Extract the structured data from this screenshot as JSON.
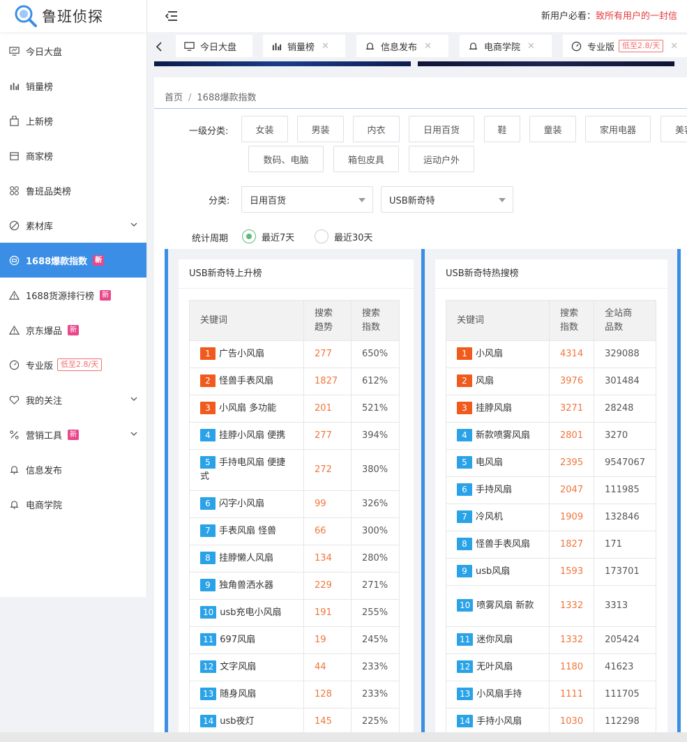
{
  "logo": {
    "text": "鲁班侦探"
  },
  "sidebar": {
    "items": [
      {
        "label": "今日大盘",
        "icon": "monitor-icon"
      },
      {
        "label": "销量榜",
        "icon": "bar-chart-icon"
      },
      {
        "label": "上新榜",
        "icon": "bag-icon"
      },
      {
        "label": "商家榜",
        "icon": "store-icon"
      },
      {
        "label": "鲁班品类榜",
        "icon": "grid-icon"
      },
      {
        "label": "素材库",
        "icon": "compass-icon"
      },
      {
        "label": "1688爆款指数",
        "icon": "dashboard-icon",
        "badge": "新"
      },
      {
        "label": "1688货源排行榜",
        "icon": "warning-icon",
        "badge": "新"
      },
      {
        "label": "京东爆品",
        "icon": "warning-icon",
        "badge": "新"
      },
      {
        "label": "专业版",
        "icon": "gauge-icon",
        "price_tag": "低至2.8/天"
      },
      {
        "label": "我的关注",
        "icon": "heart-icon"
      },
      {
        "label": "营销工具",
        "icon": "tools-icon",
        "badge": "新"
      },
      {
        "label": "信息发布",
        "icon": "bell-icon"
      },
      {
        "label": "电商学院",
        "icon": "bell-icon"
      }
    ]
  },
  "topbar": {
    "notice_label": "新用户必看：",
    "notice_link": "致所有用户的一封信"
  },
  "tabs": [
    {
      "label": "今日大盘"
    },
    {
      "label": "销量榜"
    },
    {
      "label": "信息发布"
    },
    {
      "label": "电商学院"
    },
    {
      "label": "专业版",
      "price_tag": "低至2.8/天"
    }
  ],
  "breadcrumb": {
    "home": "首页",
    "sep": "/",
    "current": "1688爆款指数"
  },
  "filters": {
    "level1_label": "一级分类:",
    "categories": [
      "女装",
      "男装",
      "内衣",
      "日用百货",
      "鞋",
      "童装",
      "家用电器",
      "美容",
      "数码、电脑",
      "箱包皮具",
      "运动户外"
    ],
    "category_label": "分类:",
    "select1": "日用百货",
    "select2": "USB新奇特",
    "period_label": "统计周期",
    "period_options": [
      "最近7天",
      "最近30天"
    ]
  },
  "rising": {
    "title": "USB新奇特上升榜",
    "headers": [
      "关键词",
      "搜索\n趋势",
      "搜索\n指数"
    ],
    "rows": [
      {
        "rank": "1",
        "keyword": "广告小风扇",
        "trend": "277",
        "index": "650%"
      },
      {
        "rank": "2",
        "keyword": "怪兽手表风扇",
        "trend": "1827",
        "index": "612%"
      },
      {
        "rank": "3",
        "keyword": "小风扇 多功能",
        "trend": "201",
        "index": "521%"
      },
      {
        "rank": "4",
        "keyword": "挂脖小风扇 便携",
        "trend": "277",
        "index": "394%"
      },
      {
        "rank": "5",
        "keyword": "手持电风扇 便捷式",
        "trend": "272",
        "index": "380%"
      },
      {
        "rank": "6",
        "keyword": "闪字小风扇",
        "trend": "99",
        "index": "326%"
      },
      {
        "rank": "7",
        "keyword": "手表风扇 怪兽",
        "trend": "66",
        "index": "300%"
      },
      {
        "rank": "8",
        "keyword": "挂脖懒人风扇",
        "trend": "134",
        "index": "280%"
      },
      {
        "rank": "9",
        "keyword": "独角兽洒水器",
        "trend": "229",
        "index": "271%"
      },
      {
        "rank": "10",
        "keyword": "usb充电小风扇",
        "trend": "191",
        "index": "255%"
      },
      {
        "rank": "11",
        "keyword": "697风扇",
        "trend": "19",
        "index": "245%"
      },
      {
        "rank": "12",
        "keyword": "文字风扇",
        "trend": "44",
        "index": "233%"
      },
      {
        "rank": "13",
        "keyword": "随身风扇",
        "trend": "128",
        "index": "233%"
      },
      {
        "rank": "14",
        "keyword": "usb夜灯",
        "trend": "145",
        "index": "225%"
      }
    ]
  },
  "hot": {
    "title": "USB新奇特热搜榜",
    "headers": [
      "关键词",
      "搜索\n指数",
      "全站商\n品数"
    ],
    "rows": [
      {
        "rank": "1",
        "keyword": "小风扇",
        "index": "4314",
        "count": "329088"
      },
      {
        "rank": "2",
        "keyword": "风扇",
        "index": "3976",
        "count": "301484"
      },
      {
        "rank": "3",
        "keyword": "挂脖风扇",
        "index": "3271",
        "count": "28248"
      },
      {
        "rank": "4",
        "keyword": "新款喷雾风扇",
        "index": "2801",
        "count": "3270"
      },
      {
        "rank": "5",
        "keyword": "电风扇",
        "index": "2395",
        "count": "9547067"
      },
      {
        "rank": "6",
        "keyword": "手持风扇",
        "index": "2047",
        "count": "111985"
      },
      {
        "rank": "7",
        "keyword": "冷风机",
        "index": "1909",
        "count": "132846"
      },
      {
        "rank": "8",
        "keyword": "怪兽手表风扇",
        "index": "1827",
        "count": "171"
      },
      {
        "rank": "9",
        "keyword": "usb风扇",
        "index": "1593",
        "count": "173701"
      },
      {
        "rank": "10",
        "keyword": "喷雾风扇 新款",
        "index": "1332",
        "count": "3313"
      },
      {
        "rank": "11",
        "keyword": "迷你风扇",
        "index": "1332",
        "count": "205424"
      },
      {
        "rank": "12",
        "keyword": "无叶风扇",
        "index": "1180",
        "count": "41623"
      },
      {
        "rank": "13",
        "keyword": "小风扇手持",
        "index": "1111",
        "count": "111705"
      },
      {
        "rank": "14",
        "keyword": "手持小风扇",
        "index": "1030",
        "count": "112298"
      }
    ]
  },
  "colors": {
    "accent": "#3a8ee6",
    "rank_top": "#f05a1c",
    "rank_norm": "#2aa2e8",
    "num": "#f0753c",
    "badge": "#e8488b"
  }
}
